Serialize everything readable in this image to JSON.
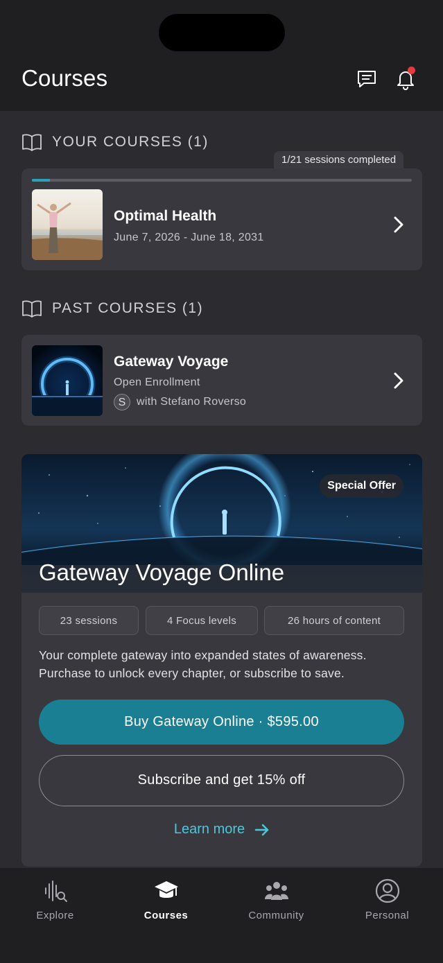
{
  "header": {
    "title": "Courses"
  },
  "your_courses": {
    "heading": "YOUR COURSES (1)",
    "sessions_badge": "1/21 sessions completed",
    "progress_fraction": 0.048,
    "course": {
      "title": "Optimal Health",
      "dates": "June 7, 2026 - June 18, 2031"
    }
  },
  "past_courses": {
    "heading": "PAST COURSES (1)",
    "course": {
      "title": "Gateway Voyage",
      "status": "Open Enrollment",
      "instructor_initial": "S",
      "instructor": "with Stefano Roverso"
    }
  },
  "promo": {
    "badge": "Special Offer",
    "title": "Gateway Voyage Online",
    "chips": [
      "23 sessions",
      "4 Focus levels",
      "26 hours of content"
    ],
    "description_line1": "Your complete gateway into expanded states of awareness.",
    "description_line2": "Purchase to unlock every chapter, or subscribe to save.",
    "buy_label": "Buy Gateway Online  ·  $595.00",
    "subscribe_label": "Subscribe and get 15% off",
    "learn_more": "Learn more"
  },
  "tabs": [
    {
      "label": "Explore",
      "icon": "explore-icon",
      "active": false
    },
    {
      "label": "Courses",
      "icon": "graduation-cap-icon",
      "active": true
    },
    {
      "label": "Community",
      "icon": "community-icon",
      "active": false
    },
    {
      "label": "Personal",
      "icon": "person-icon",
      "active": false
    }
  ],
  "colors": {
    "accent": "#1b7f94",
    "link": "#49c8de",
    "notification": "#e8393f"
  }
}
